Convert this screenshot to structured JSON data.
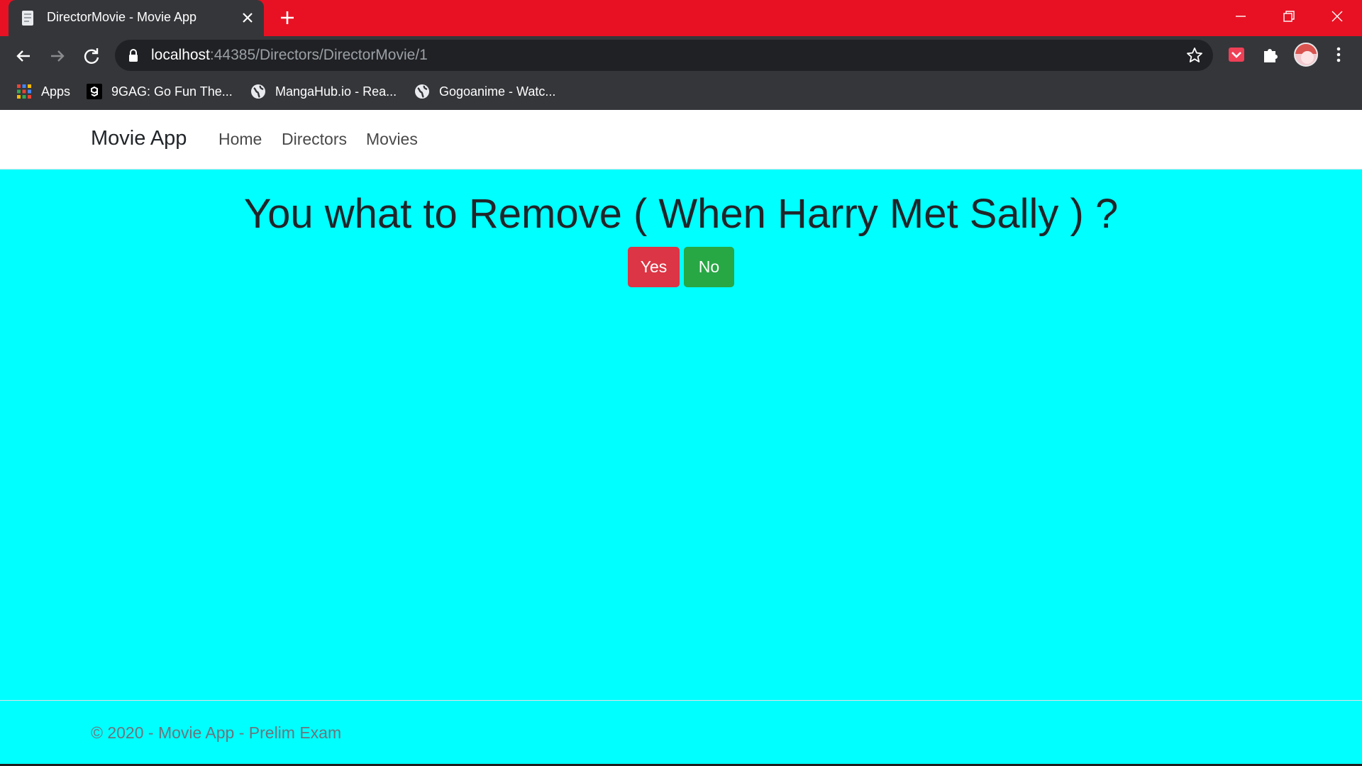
{
  "browser": {
    "tab_title": "DirectorMovie - Movie App",
    "url_host": "localhost",
    "url_path": ":44385/Directors/DirectorMovie/1",
    "tabstrip_color": "#e81123",
    "bookmarks": [
      {
        "label": "Apps",
        "icon": "apps-grid-icon"
      },
      {
        "label": "9GAG: Go Fun The...",
        "icon": "9gag-icon"
      },
      {
        "label": "MangaHub.io - Rea...",
        "icon": "globe-icon"
      },
      {
        "label": "Gogoanime - Watc...",
        "icon": "globe-icon"
      }
    ]
  },
  "navbar": {
    "brand": "Movie App",
    "links": [
      "Home",
      "Directors",
      "Movies"
    ]
  },
  "main": {
    "heading": "You what to Remove ( When Harry Met Sally ) ?",
    "yes_label": "Yes",
    "no_label": "No",
    "background": "#00ffff",
    "yes_color": "#dc3545",
    "no_color": "#28a745"
  },
  "footer": {
    "text": "© 2020 - Movie App - Prelim Exam"
  }
}
